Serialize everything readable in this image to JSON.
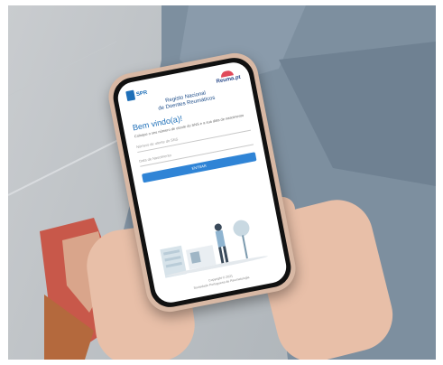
{
  "screen": {
    "spr_logo_text": "SPR",
    "reuma_logo_text": "Reuma.pt",
    "title_line1": "Registo Nacional",
    "title_line2": "de Doentes Reumáticos",
    "welcome": "Bem vindo(a)!",
    "instructions": "Coloque o seu número de utente do SNS e a sua data de nascimento",
    "field1_placeholder": "Número de utente do SNS",
    "field2_placeholder": "Data de Nascimento",
    "button_label": "ENTRAR",
    "footer_line1": "Copyright © 2021",
    "footer_line2": "Sociedade Portuguesa de Reumatologia"
  },
  "colors": {
    "accent": "#2f84d6",
    "title": "#1f4e8a",
    "case": "#d8b8a4"
  }
}
